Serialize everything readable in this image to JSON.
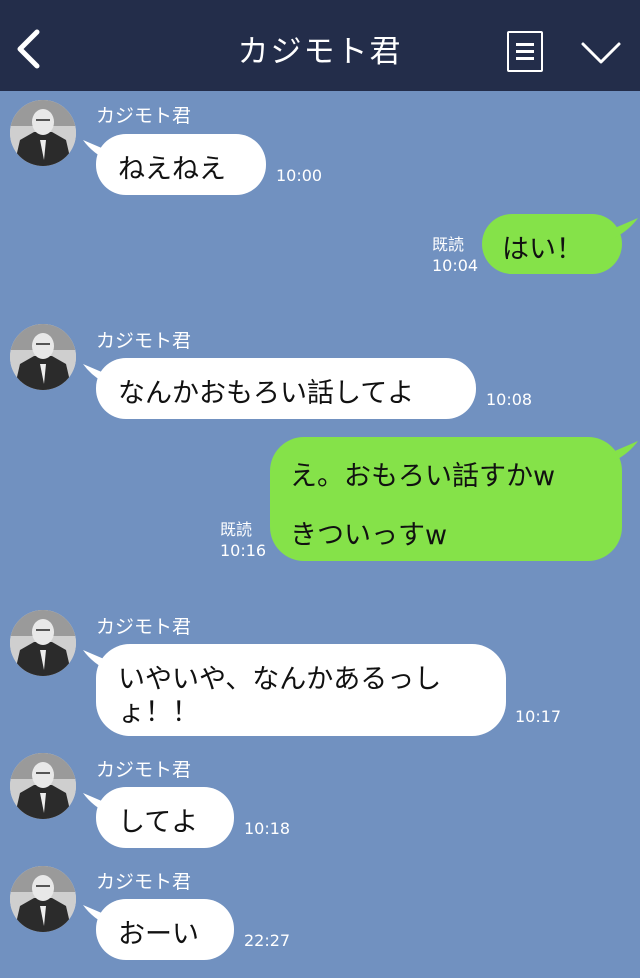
{
  "header": {
    "title": "カジモト君"
  },
  "messages": [
    {
      "sender": "カジモト君",
      "lines": [
        "ねえねえ"
      ],
      "time": "10:00"
    },
    {
      "lines": [
        "はい！"
      ],
      "read": "既読",
      "time": "10:04"
    },
    {
      "sender": "カジモト君",
      "lines": [
        "なんかおもろい話してよ"
      ],
      "time": "10:08"
    },
    {
      "lines": [
        "え。おもろい話すかw",
        "きついっすw"
      ],
      "read": "既読",
      "time": "10:16"
    },
    {
      "sender": "カジモト君",
      "lines": [
        "いやいや、なんかあるっし",
        "ょ！！"
      ],
      "time": "10:17"
    },
    {
      "sender": "カジモト君",
      "lines": [
        "してよ"
      ],
      "time": "10:18"
    },
    {
      "sender": "カジモト君",
      "lines": [
        "おーい"
      ],
      "time": "22:27"
    }
  ],
  "colors": {
    "header_bg": "#232d4a",
    "chat_bg": "#7191c0",
    "incoming_bubble": "#ffffff",
    "outgoing_bubble": "#85e249"
  }
}
